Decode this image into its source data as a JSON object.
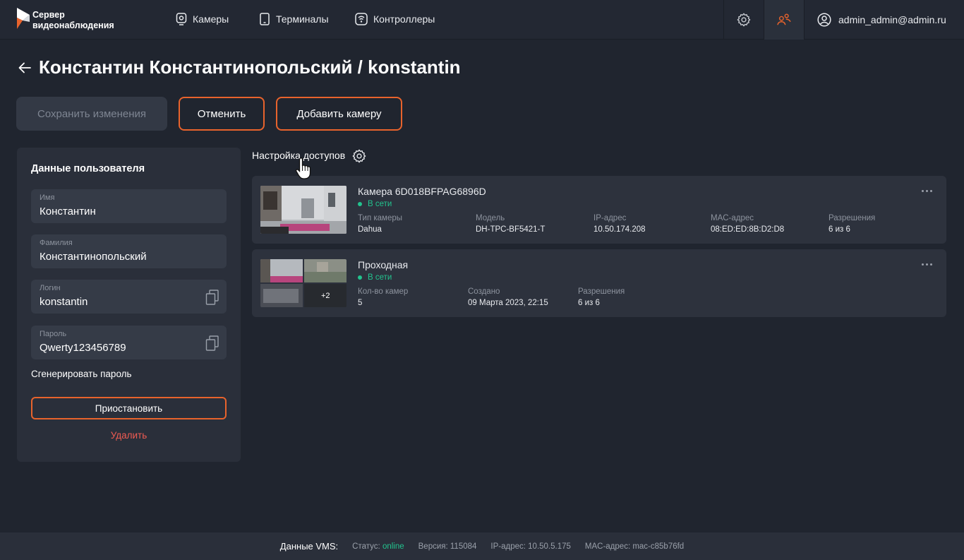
{
  "app": {
    "logo_line1": "Сервер",
    "logo_line2": "видеонаблюдения",
    "accent_color": "#e8632c",
    "online_color": "#22c38e"
  },
  "nav": {
    "items": [
      {
        "label": "Камеры",
        "icon": "camera-icon"
      },
      {
        "label": "Терминалы",
        "icon": "tablet-icon"
      },
      {
        "label": "Контроллеры",
        "icon": "controller-icon"
      }
    ],
    "settings_icon": "gear-icon",
    "users_icon": "users-icon",
    "user_email": "admin_admin@admin.ru"
  },
  "header": {
    "title": "Константин Константинопольский / konstantin",
    "save_label": "Сохранить изменения",
    "cancel_label": "Отменить",
    "add_camera_label": "Добавить камеру"
  },
  "user_panel": {
    "title": "Данные пользователя",
    "fields": {
      "first_name": {
        "label": "Имя",
        "value": "Константин"
      },
      "last_name": {
        "label": "Фамилия",
        "value": "Константинопольский"
      },
      "login": {
        "label": "Логин",
        "value": "konstantin"
      },
      "password": {
        "label": "Пароль",
        "value": "Qwerty123456789"
      }
    },
    "generate_password": "Сгенерировать пароль",
    "suspend_label": "Приостановить",
    "delete_label": "Удалить"
  },
  "access": {
    "title": "Настройка доступов",
    "cards": [
      {
        "title": "Камера 6D018BFPAG6896D",
        "status": "В сети",
        "columns": [
          {
            "label": "Тип камеры",
            "value": "Dahua"
          },
          {
            "label": "Модель",
            "value": "DH-TPC-BF5421-T"
          },
          {
            "label": "IP-адрес",
            "value": "10.50.174.208"
          },
          {
            "label": "MAC-адрес",
            "value": "08:ED:ED:8B:D2:D8"
          },
          {
            "label": "Разрешения",
            "value": "6 из 6"
          }
        ]
      },
      {
        "title": "Проходная",
        "status": "В сети",
        "extra_count": "+2",
        "columns": [
          {
            "label": "Кол-во камер",
            "value": "5"
          },
          {
            "label": "Создано",
            "value": "09 Марта 2023, 22:15"
          },
          {
            "label": "Разрешения",
            "value": "6 из 6"
          }
        ]
      }
    ]
  },
  "footer": {
    "title": "Данные VMS:",
    "status_label": "Статус:",
    "status_value": "online",
    "version": "Версия: 115084",
    "ip": "IP-адрес: 10.50.5.175",
    "mac": "MAC-адрес: mac-c85b76fd"
  }
}
